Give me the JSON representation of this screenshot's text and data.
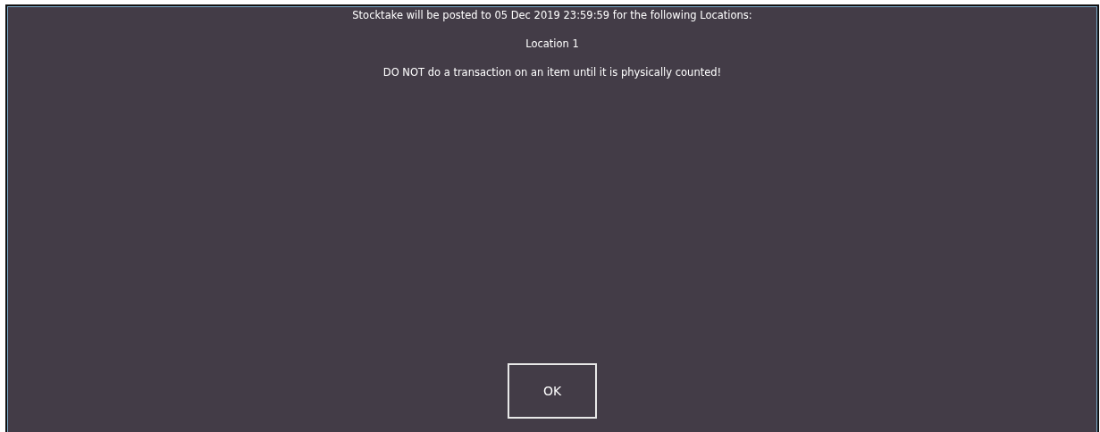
{
  "dialog": {
    "messages": [
      "Stocktake will be posted to 05 Dec 2019 23:59:59 for the following Locations:",
      "Location 1",
      "DO NOT do a transaction on an item until it is physically counted!"
    ],
    "buttons": [
      {
        "label": "OK"
      }
    ]
  }
}
